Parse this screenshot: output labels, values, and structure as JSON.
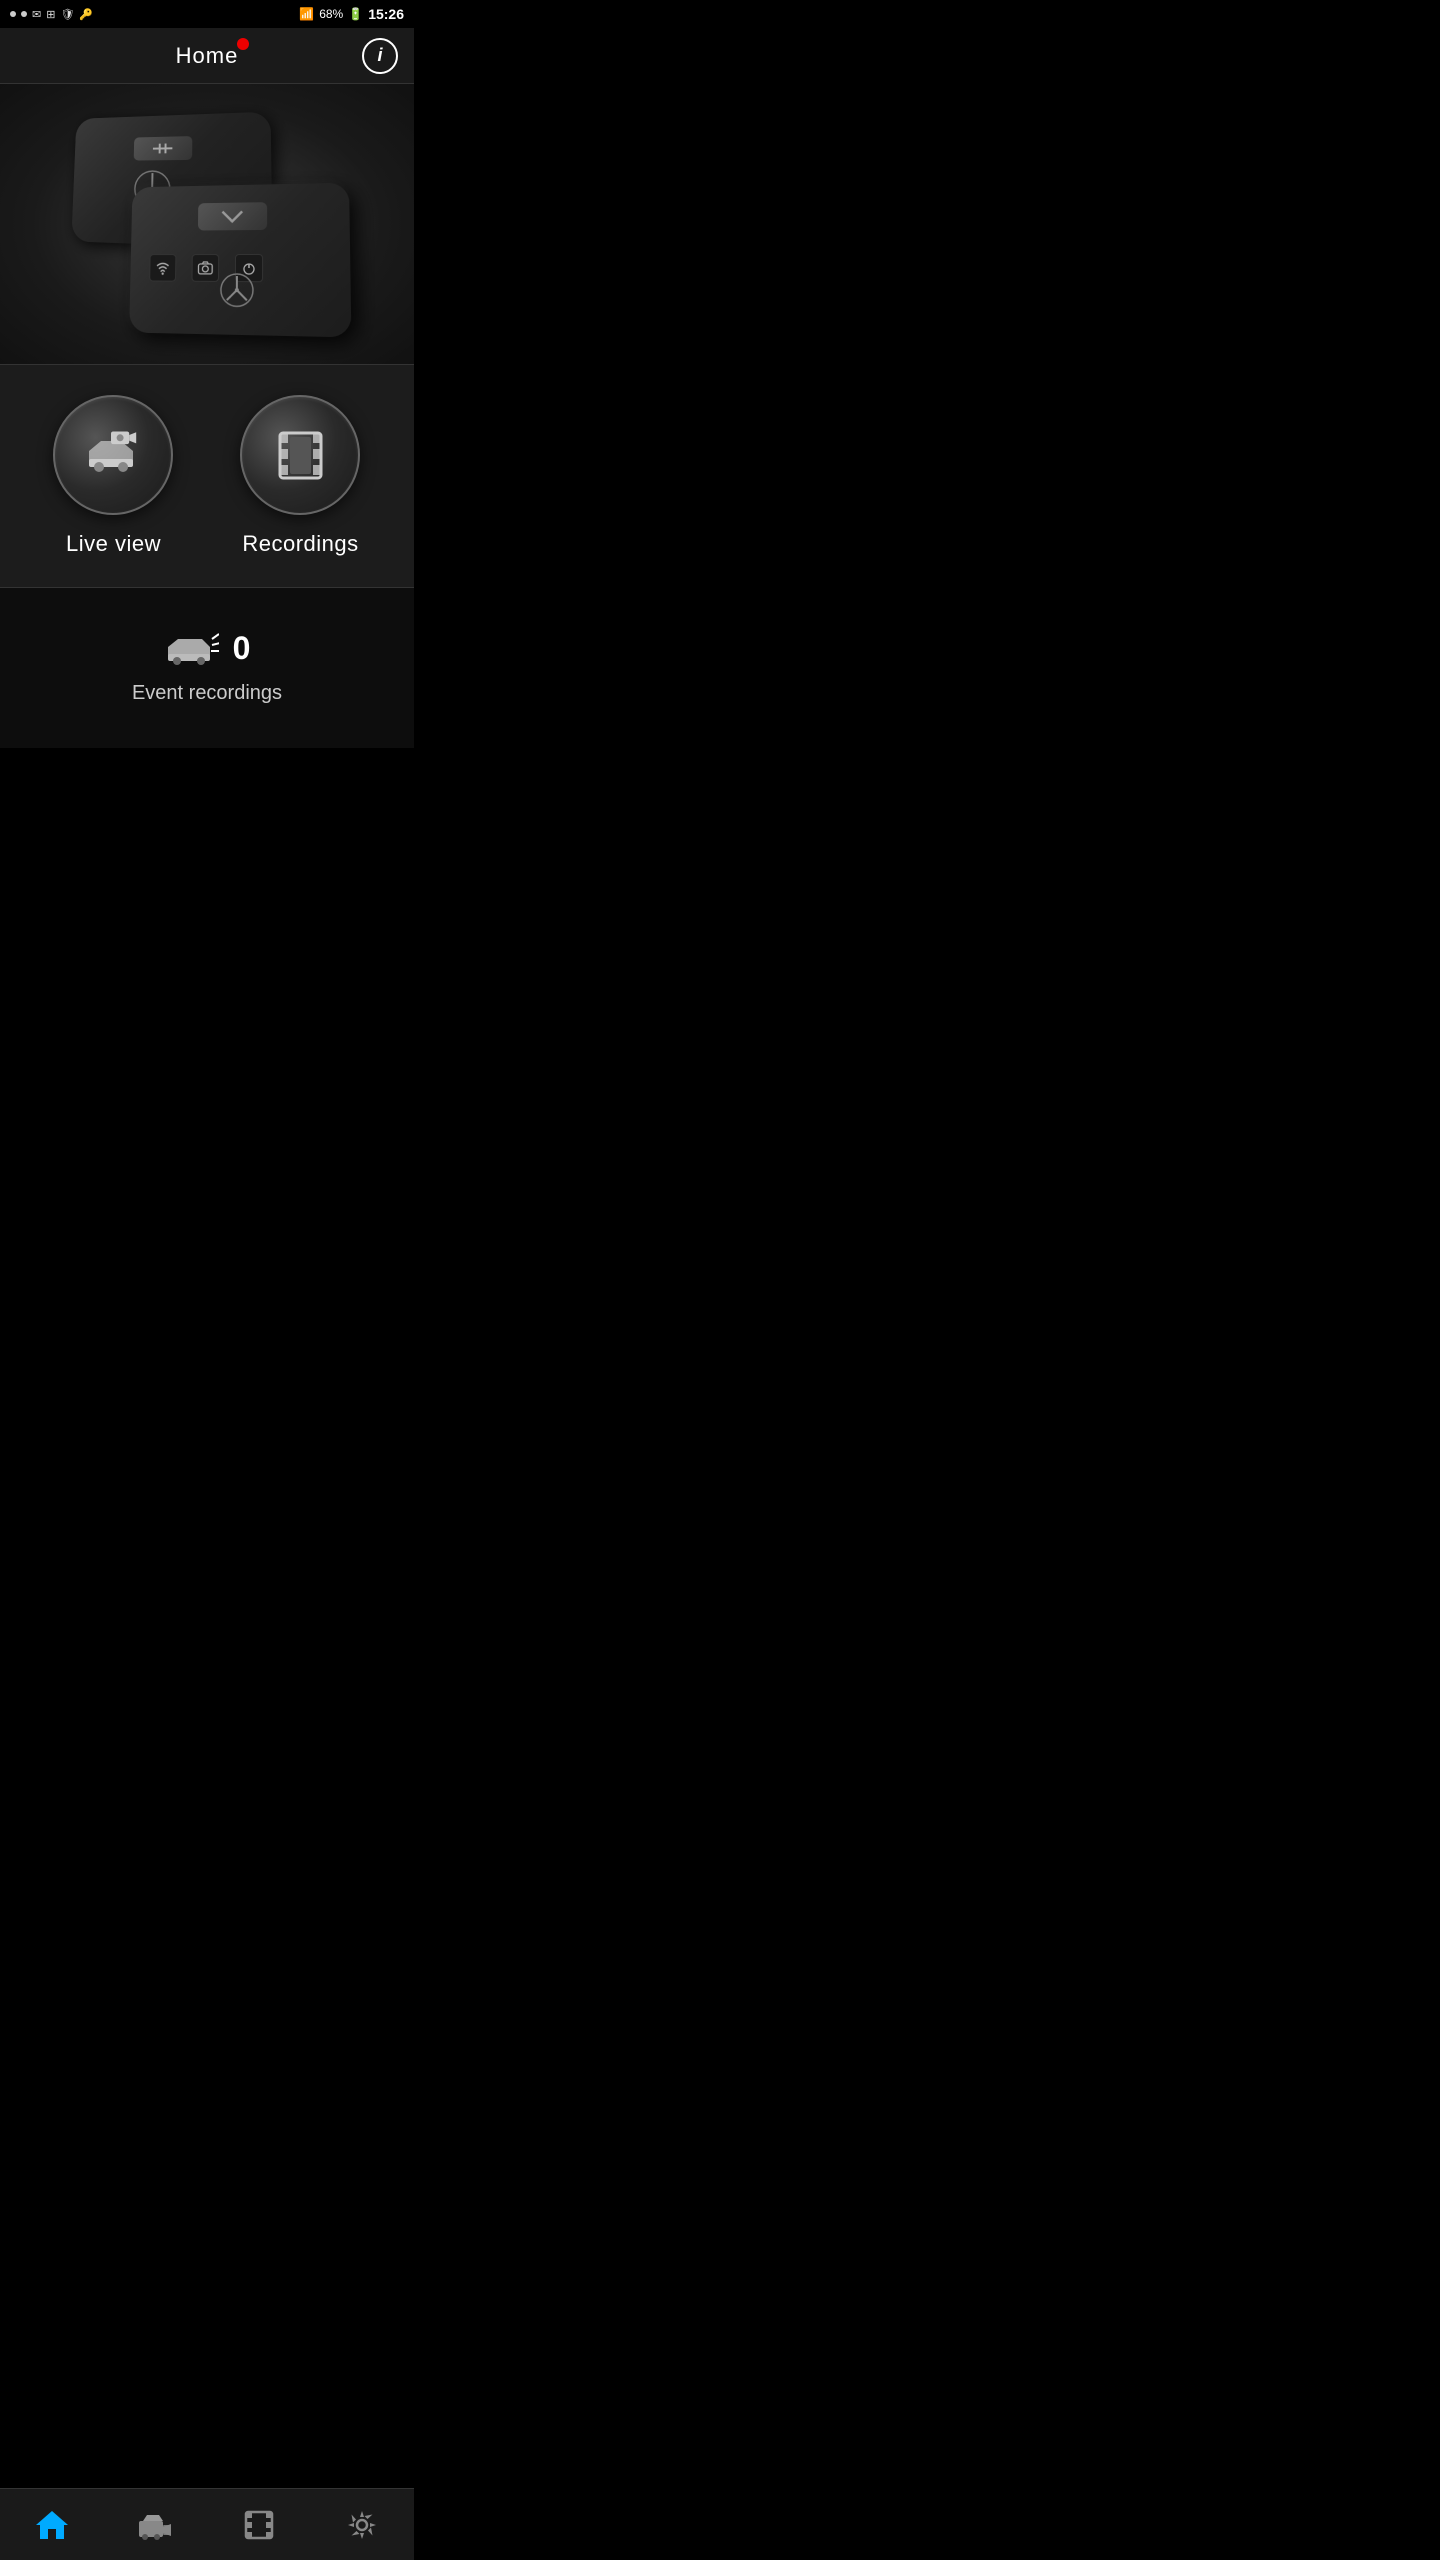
{
  "status": {
    "battery": "68%",
    "time": "15:26",
    "signal": "signal"
  },
  "header": {
    "title": "Home",
    "info_label": "i"
  },
  "main_nav": {
    "live_view_label": "Live view",
    "recordings_label": "Recordings"
  },
  "event_section": {
    "count": "0",
    "label": "Event recordings"
  },
  "bottom_nav": {
    "home_label": "Home",
    "camera_label": "Camera",
    "recordings_label": "Recordings",
    "settings_label": "Settings"
  }
}
